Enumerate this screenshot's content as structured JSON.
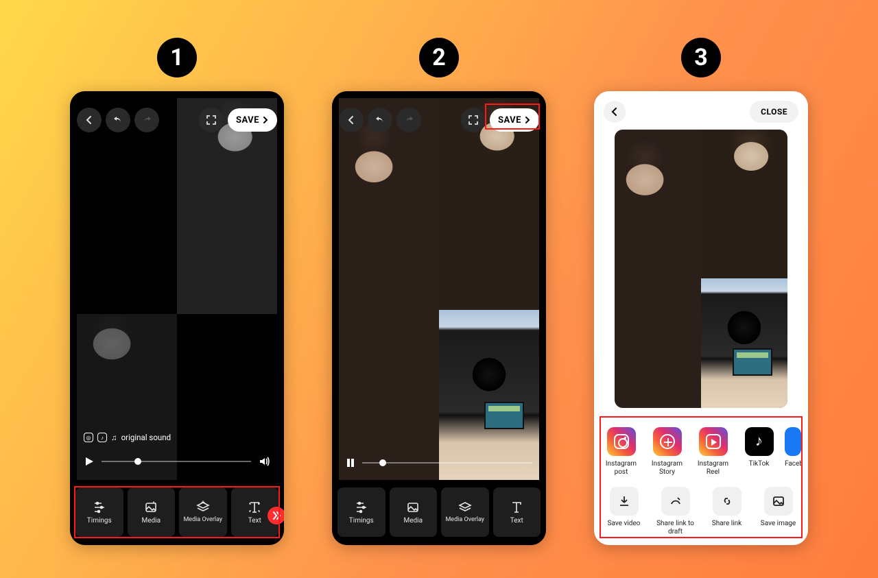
{
  "badges": [
    "1",
    "2",
    "3"
  ],
  "editor": {
    "save_label": "SAVE",
    "sound_label": "original sound",
    "tools": {
      "timings": "Timings",
      "media": "Media",
      "media_overlay": "Media Overlay",
      "text": "Text"
    },
    "tool_order": [
      "timings",
      "media",
      "media_overlay",
      "text"
    ]
  },
  "screen3": {
    "close_label": "CLOSE",
    "share_row1": [
      {
        "key": "instagram_post",
        "label": "Instagram post"
      },
      {
        "key": "instagram_story",
        "label": "Instagram Story"
      },
      {
        "key": "instagram_reel",
        "label": "Instagram Reel"
      },
      {
        "key": "tiktok",
        "label": "TikTok"
      },
      {
        "key": "facebook_story",
        "label": "Faceb... S..."
      }
    ],
    "share_row2": [
      {
        "key": "save_video",
        "label": "Save video"
      },
      {
        "key": "share_link_draft",
        "label": "Share link to draft"
      },
      {
        "key": "share_link",
        "label": "Share link"
      },
      {
        "key": "save_image",
        "label": "Save image"
      }
    ]
  }
}
